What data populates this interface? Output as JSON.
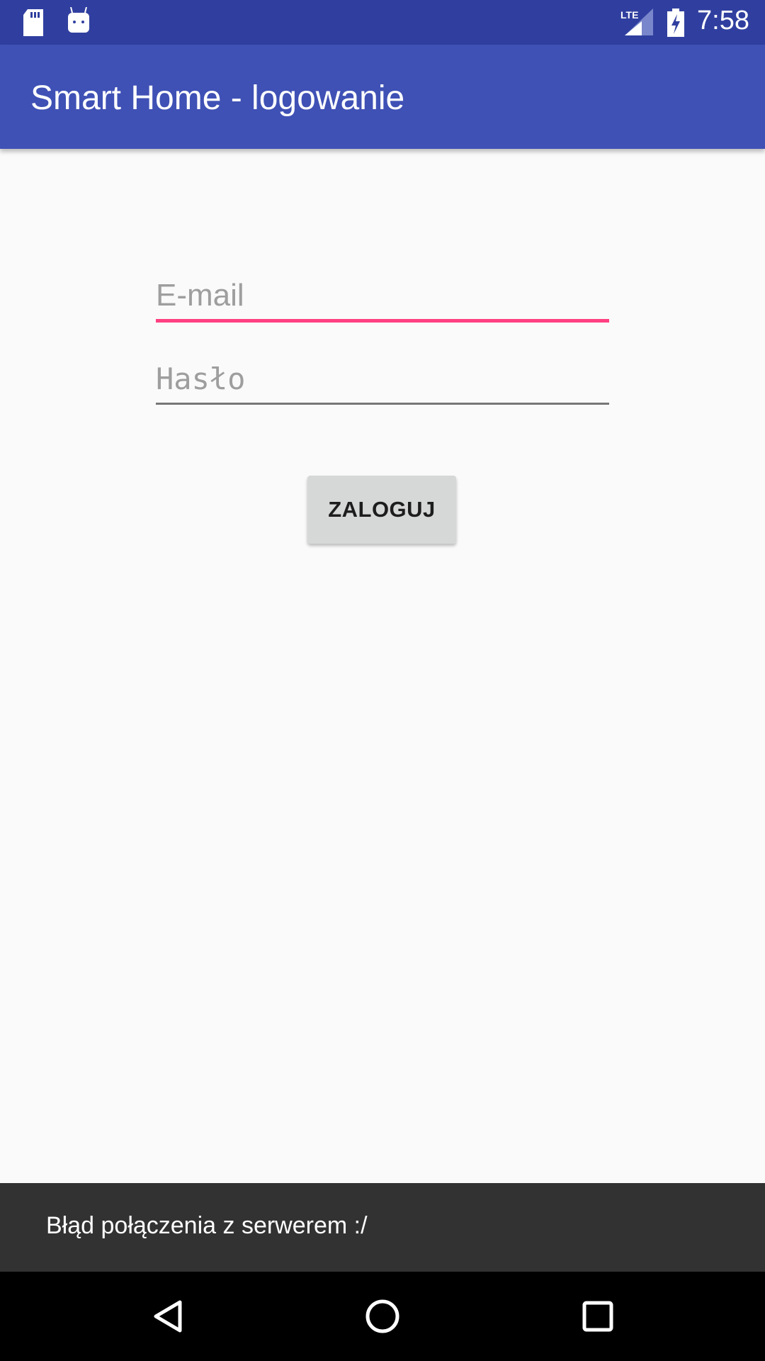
{
  "status_bar": {
    "time": "7:58",
    "network": "LTE",
    "icons": [
      "sd-card-icon",
      "android-icon",
      "lte-signal-icon",
      "battery-charging-icon"
    ]
  },
  "app_bar": {
    "title": "Smart Home - logowanie"
  },
  "form": {
    "email_placeholder": "E-mail",
    "password_placeholder": "Hasło",
    "login_label": "ZALOGUJ"
  },
  "snackbar": {
    "message": "Błąd połączenia z serwerem :/"
  },
  "colors": {
    "primary": "#3F51B5",
    "primary_dark": "#303F9F",
    "accent": "#FF4081"
  }
}
